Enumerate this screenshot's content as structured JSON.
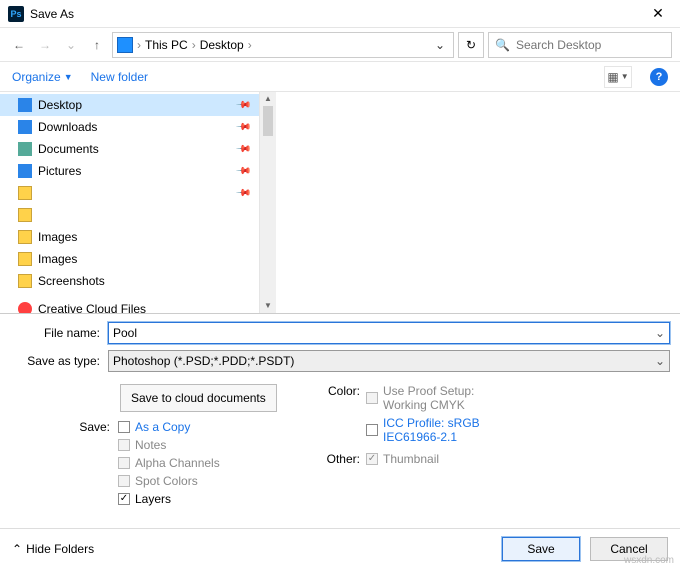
{
  "titlebar": {
    "title": "Save As"
  },
  "nav": {
    "breadcrumb": {
      "part1": "This PC",
      "part2": "Desktop"
    },
    "search_placeholder": "Search Desktop"
  },
  "toolbar": {
    "organize": "Organize",
    "new_folder": "New folder"
  },
  "tree": [
    {
      "icon": "ic-desktop",
      "label": "Desktop",
      "pinned": true,
      "selected": true
    },
    {
      "icon": "ic-down",
      "label": "Downloads",
      "pinned": true
    },
    {
      "icon": "ic-doc",
      "label": "Documents",
      "pinned": true
    },
    {
      "icon": "ic-pic",
      "label": "Pictures",
      "pinned": true
    },
    {
      "icon": "ic-folder",
      "label": "",
      "pinned": true
    },
    {
      "icon": "ic-folder",
      "label": "",
      "pinned": false
    },
    {
      "icon": "ic-folder",
      "label": "Images",
      "pinned": false
    },
    {
      "icon": "ic-folder",
      "label": "Images",
      "pinned": false
    },
    {
      "icon": "ic-folder",
      "label": "Screenshots",
      "pinned": false
    },
    {
      "icon": "ic-cc",
      "label": "Creative Cloud Files",
      "pinned": false
    }
  ],
  "form": {
    "filename_label": "File name:",
    "filename_value": "Pool",
    "type_label": "Save as type:",
    "type_value": "Photoshop (*.PSD;*.PDD;*.PSDT)",
    "cloud_button": "Save to cloud documents",
    "save_label": "Save:",
    "as_copy": "As a Copy",
    "notes": "Notes",
    "alpha": "Alpha Channels",
    "spot": "Spot Colors",
    "layers": "Layers",
    "color_label": "Color:",
    "proof1": "Use Proof Setup:",
    "proof2": "Working CMYK",
    "icc1": "ICC Profile:  sRGB",
    "icc2": "IEC61966-2.1",
    "other_label": "Other:",
    "thumbnail": "Thumbnail"
  },
  "footer": {
    "hide": "Hide Folders",
    "save": "Save",
    "cancel": "Cancel"
  },
  "watermark": "wsxdn.com"
}
